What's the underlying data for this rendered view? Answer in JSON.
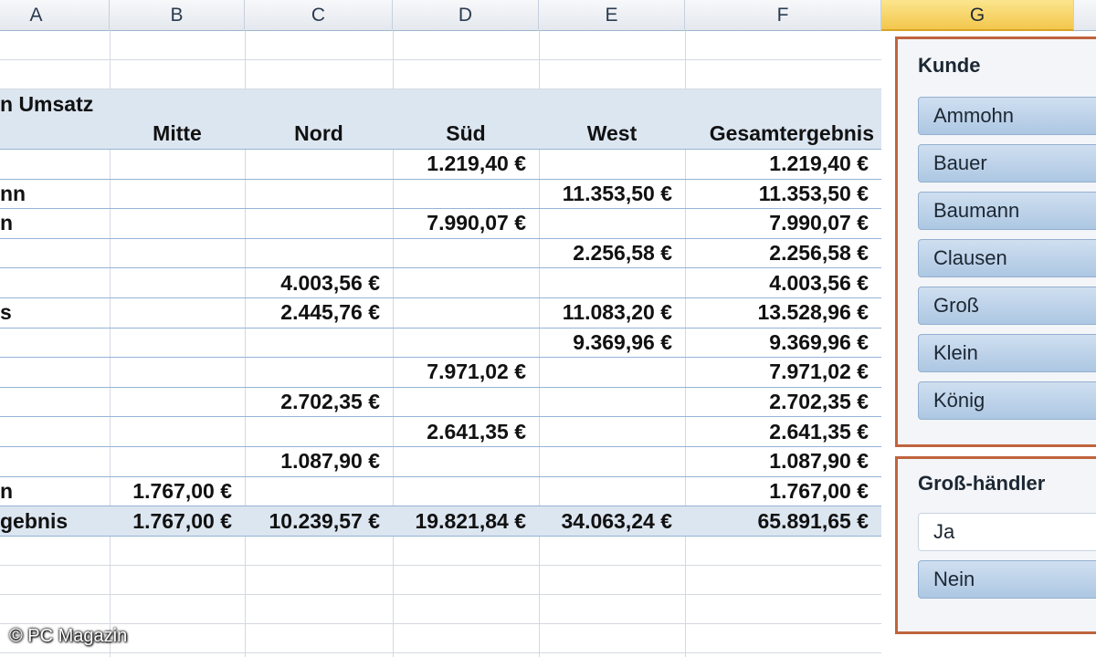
{
  "columns": [
    "A",
    "B",
    "C",
    "D",
    "E",
    "F",
    "G"
  ],
  "pivot": {
    "value_label": "n Umsatz",
    "headers": [
      "",
      "Mitte",
      "Nord",
      "Süd",
      "West",
      "Gesamtergebnis"
    ],
    "rows": [
      {
        "label": "",
        "values": [
          "",
          "",
          "1.219,40 €",
          "",
          "1.219,40 €"
        ]
      },
      {
        "label": "nn",
        "values": [
          "",
          "",
          "",
          "11.353,50 €",
          "11.353,50 €"
        ]
      },
      {
        "label": "n",
        "values": [
          "",
          "",
          "7.990,07 €",
          "",
          "7.990,07 €"
        ]
      },
      {
        "label": "",
        "values": [
          "",
          "",
          "",
          "2.256,58 €",
          "2.256,58 €"
        ]
      },
      {
        "label": "",
        "values": [
          "",
          "4.003,56 €",
          "",
          "",
          "4.003,56 €"
        ]
      },
      {
        "label": "s",
        "values": [
          "",
          "2.445,76 €",
          "",
          "11.083,20 €",
          "13.528,96 €"
        ]
      },
      {
        "label": "",
        "values": [
          "",
          "",
          "",
          "9.369,96 €",
          "9.369,96 €"
        ]
      },
      {
        "label": "",
        "values": [
          "",
          "",
          "7.971,02 €",
          "",
          "7.971,02 €"
        ]
      },
      {
        "label": "",
        "values": [
          "",
          "2.702,35 €",
          "",
          "",
          "2.702,35 €"
        ]
      },
      {
        "label": "",
        "values": [
          "",
          "",
          "2.641,35 €",
          "",
          "2.641,35 €"
        ]
      },
      {
        "label": "",
        "values": [
          "",
          "1.087,90 €",
          "",
          "",
          "1.087,90 €"
        ]
      },
      {
        "label": "n",
        "values": [
          "1.767,00 €",
          "",
          "",
          "",
          "1.767,00 €"
        ]
      }
    ],
    "total": {
      "label": "gebnis",
      "values": [
        "1.767,00 €",
        "10.239,57 €",
        "19.821,84 €",
        "34.063,24 €",
        "65.891,65 €"
      ]
    }
  },
  "slicer_kunde": {
    "title": "Kunde",
    "items": [
      "Ammohn",
      "Bauer",
      "Baumann",
      "Clausen",
      "Groß",
      "Klein",
      "König"
    ]
  },
  "slicer_haendler": {
    "title": "Groß-händler",
    "items": [
      {
        "label": "Ja",
        "selected": false
      },
      {
        "label": "Nein",
        "selected": true
      }
    ]
  },
  "watermark": "© PC Magazin",
  "colors": {
    "accent": "#c0643d",
    "band": "#dce6f1",
    "slicer_item": "#bcd3ea"
  }
}
